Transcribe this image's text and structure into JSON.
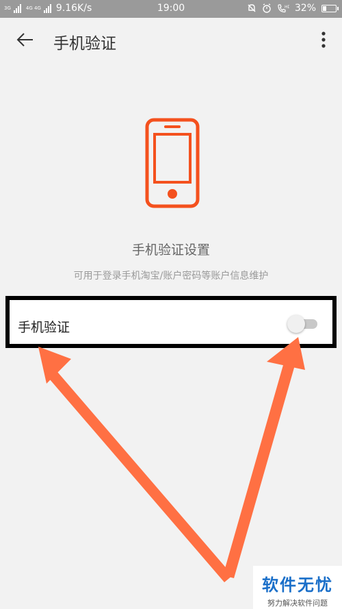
{
  "status_bar": {
    "network_left": "3G",
    "network_right": "4G 4G",
    "speed": "9.16K/s",
    "time": "19:00",
    "battery": "32%",
    "battery_fill": 0.32
  },
  "app_bar": {
    "back_icon": "arrow-left-icon",
    "title": "手机验证",
    "more_icon": "more-vertical-icon"
  },
  "hero": {
    "icon": "smartphone-icon",
    "accent_color": "#f4511e",
    "title": "手机验证设置",
    "subtitle": "可用于登录手机淘宝/账户密码等账户信息维护"
  },
  "setting_row": {
    "label": "手机验证",
    "toggle_state": "off"
  },
  "annotation": {
    "arrow_color": "#ff7043"
  },
  "watermark": {
    "main": "软件无忧",
    "sub": "努力解决软件问题"
  }
}
